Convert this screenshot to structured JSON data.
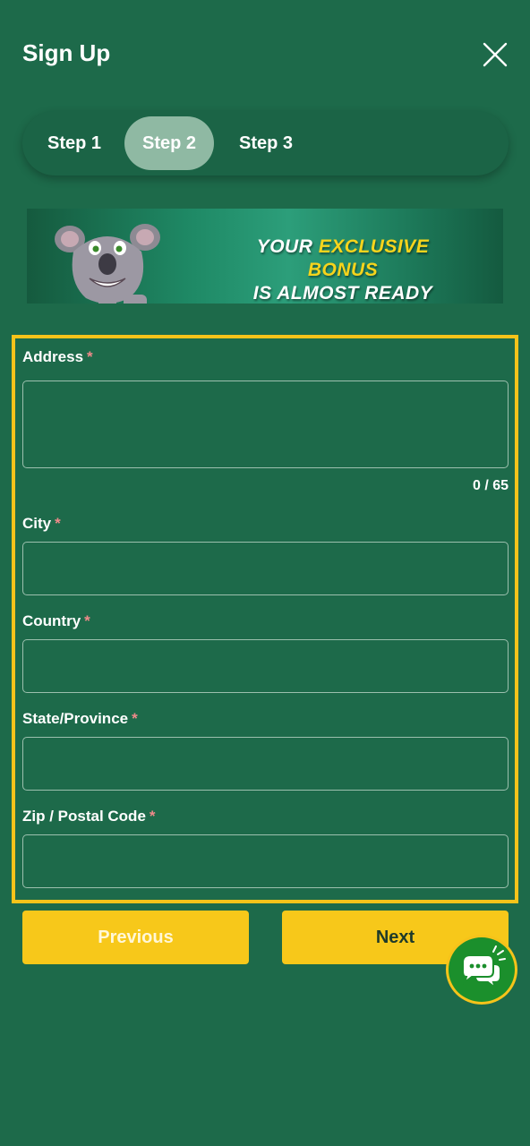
{
  "header": {
    "title": "Sign Up",
    "close_icon": "close-icon"
  },
  "stepper": {
    "steps": [
      "Step 1",
      "Step 2",
      "Step 3"
    ],
    "active_step": "Step 2"
  },
  "banner": {
    "line1_prefix": "YOUR ",
    "line1_highlight": "EXCLUSIVE BONUS",
    "line2": "IS ALMOST READY",
    "mascot": "koala-mascot"
  },
  "form": {
    "address": {
      "label": "Address",
      "required_mark": "*",
      "value": "",
      "counter": "0 / 65"
    },
    "city": {
      "label": "City",
      "required_mark": "*",
      "value": ""
    },
    "country": {
      "label": "Country",
      "required_mark": "*",
      "value": ""
    },
    "state": {
      "label": "State/Province",
      "required_mark": "*",
      "value": ""
    },
    "zip": {
      "label": "Zip / Postal Code",
      "required_mark": "*",
      "value": ""
    }
  },
  "actions": {
    "previous_label": "Previous",
    "next_label": "Next"
  },
  "chat": {
    "icon": "chat-bubbles-icon"
  },
  "colors": {
    "background": "#1d6a4a",
    "accent_yellow": "#f7c81a",
    "active_step": "#8fb9a3",
    "required": "#f08a8a"
  }
}
